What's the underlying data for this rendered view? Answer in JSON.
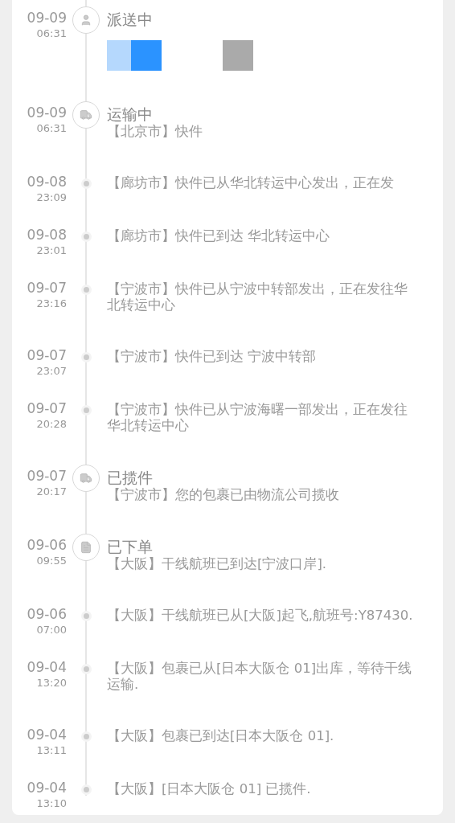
{
  "events": [
    {
      "date": "09-09",
      "time": "06:31",
      "kind": "person",
      "status": "派送中",
      "redacted": true
    },
    {
      "date": "09-09",
      "time": "06:31",
      "kind": "truck",
      "status": "运输中",
      "text": "【北京市】快件"
    },
    {
      "date": "09-08",
      "time": "23:09",
      "kind": "step",
      "text": "【廊坊市】快件已从华北转运中心发出，正在发"
    },
    {
      "date": "09-08",
      "time": "23:01",
      "kind": "step",
      "text": "【廊坊市】快件已到达 华北转运中心"
    },
    {
      "date": "09-07",
      "time": "23:16",
      "kind": "step",
      "text": "【宁波市】快件已从宁波中转部发出，正在发往华北转运中心"
    },
    {
      "date": "09-07",
      "time": "23:07",
      "kind": "step",
      "text": "【宁波市】快件已到达 宁波中转部"
    },
    {
      "date": "09-07",
      "time": "20:28",
      "kind": "step",
      "text": "【宁波市】快件已从宁波海曙一部发出，正在发往华北转运中心"
    },
    {
      "date": "09-07",
      "time": "20:17",
      "kind": "truck",
      "status": "已揽件",
      "text": "【宁波市】您的包裹已由物流公司揽收"
    },
    {
      "date": "09-06",
      "time": "09:55",
      "kind": "document",
      "status": "已下单",
      "text": "【大阪】干线航班已到达[宁波口岸]."
    },
    {
      "date": "09-06",
      "time": "07:00",
      "kind": "step",
      "text": "【大阪】干线航班已从[大阪]起飞,航班号:Y87430."
    },
    {
      "date": "09-04",
      "time": "13:20",
      "kind": "step",
      "text": "【大阪】包裹已从[日本大阪仓 01]出库，等待干线运输."
    },
    {
      "date": "09-04",
      "time": "13:11",
      "kind": "step",
      "text": "【大阪】包裹已到达[日本大阪仓 01]."
    },
    {
      "date": "09-04",
      "time": "13:10",
      "kind": "step",
      "text": "【大阪】[日本大阪仓 01] 已揽件."
    }
  ]
}
